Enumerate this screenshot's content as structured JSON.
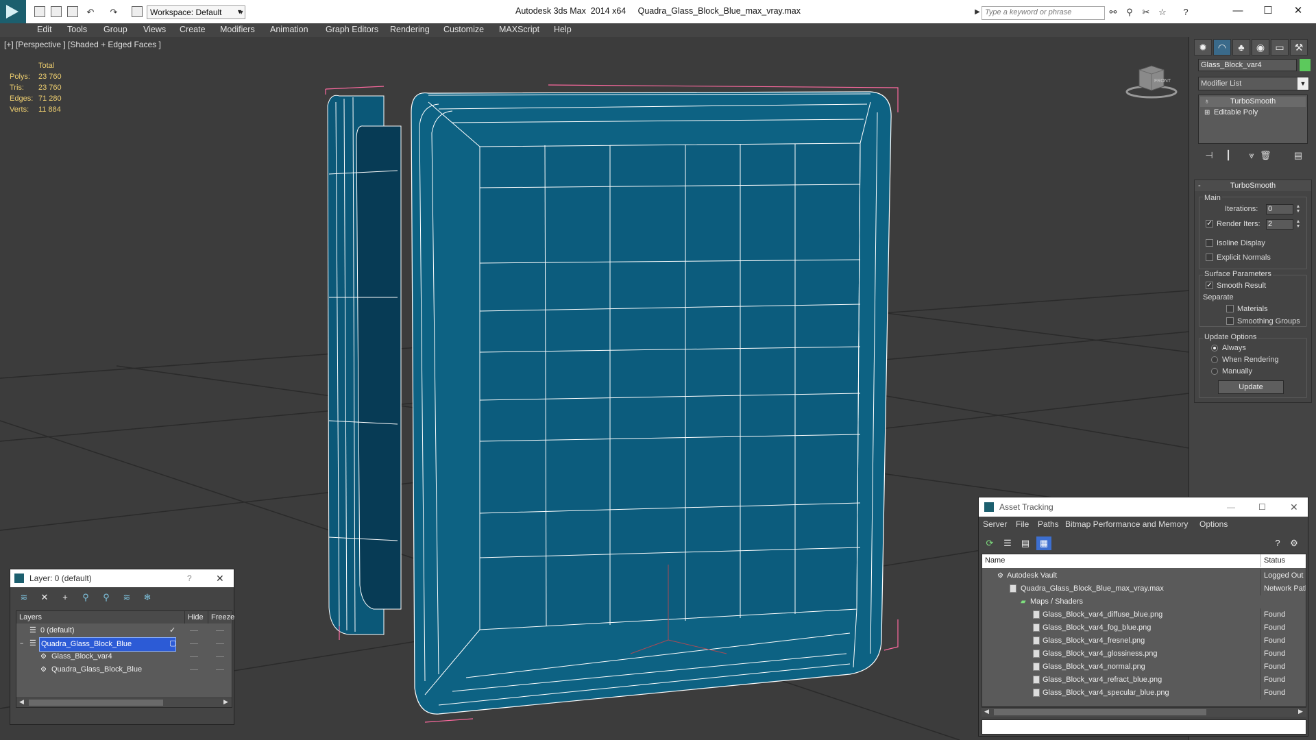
{
  "app": {
    "title": "Autodesk 3ds Max  2014 x64     Quadra_Glass_Block_Blue_max_vray.max",
    "workspace": "Workspace: Default",
    "search_placeholder": "Type a keyword or phrase"
  },
  "menu": [
    "Edit",
    "Tools",
    "Group",
    "Views",
    "Create",
    "Modifiers",
    "Animation",
    "Graph Editors",
    "Rendering",
    "Customize",
    "MAXScript",
    "Help"
  ],
  "viewport": {
    "label": "[+] [Perspective ] [Shaded + Edged Faces ]",
    "stats_header": "Total",
    "stats": [
      {
        "label": "Polys:",
        "value": "23 760"
      },
      {
        "label": "Tris:",
        "value": "23 760"
      },
      {
        "label": "Edges:",
        "value": "71 280"
      },
      {
        "label": "Verts:",
        "value": "11 884"
      }
    ],
    "viewcube_label": "FRONT",
    "colors": {
      "object": "#0d5f80",
      "wire": "#ffffff",
      "selection": "#ff6aa0",
      "background": "#3c3c3c"
    }
  },
  "command_panel": {
    "object_name": "Glass_Block_var4",
    "object_color": "#5cc95c",
    "modifier_list": "Modifier List",
    "stack": [
      "TurboSmooth",
      "Editable Poly"
    ],
    "rollout_title": "TurboSmooth",
    "main_label": "Main",
    "iterations_label": "Iterations:",
    "iterations_value": "0",
    "render_iters_label": "Render Iters:",
    "render_iters_value": "2",
    "isoline": "Isoline Display",
    "explicit_normals": "Explicit Normals",
    "surface_params": "Surface Parameters",
    "smooth_result": "Smooth Result",
    "separate": "Separate",
    "materials": "Materials",
    "smoothing_groups": "Smoothing Groups",
    "update_options": "Update Options",
    "always": "Always",
    "when_rendering": "When Rendering",
    "manually": "Manually",
    "update_button": "Update"
  },
  "layer_window": {
    "title": "Layer: 0 (default)",
    "help": "?",
    "col_layers": "Layers",
    "col_hide": "Hide",
    "col_freeze": "Freeze",
    "rows": [
      {
        "name": "0 (default)",
        "indent": 0,
        "selected": false
      },
      {
        "name": "Quadra_Glass_Block_Blue",
        "indent": 0,
        "selected": true
      },
      {
        "name": "Glass_Block_var4",
        "indent": 1,
        "selected": false
      },
      {
        "name": "Quadra_Glass_Block_Blue",
        "indent": 1,
        "selected": false
      }
    ]
  },
  "asset_window": {
    "title": "Asset Tracking",
    "menu": [
      "Server",
      "File",
      "Paths",
      "Bitmap Performance and Memory",
      "Options"
    ],
    "col_name": "Name",
    "col_status": "Status",
    "rows": [
      {
        "name": "Autodesk Vault",
        "status": "Logged Out",
        "indent": 0
      },
      {
        "name": "Quadra_Glass_Block_Blue_max_vray.max",
        "status": "Network Path",
        "indent": 1
      },
      {
        "name": "Maps / Shaders",
        "status": "",
        "indent": 2
      },
      {
        "name": "Glass_Block_var4_diffuse_blue.png",
        "status": "Found",
        "indent": 3
      },
      {
        "name": "Glass_Block_var4_fog_blue.png",
        "status": "Found",
        "indent": 3
      },
      {
        "name": "Glass_Block_var4_fresnel.png",
        "status": "Found",
        "indent": 3
      },
      {
        "name": "Glass_Block_var4_glossiness.png",
        "status": "Found",
        "indent": 3
      },
      {
        "name": "Glass_Block_var4_normal.png",
        "status": "Found",
        "indent": 3
      },
      {
        "name": "Glass_Block_var4_refract_blue.png",
        "status": "Found",
        "indent": 3
      },
      {
        "name": "Glass_Block_var4_specular_blue.png",
        "status": "Found",
        "indent": 3
      }
    ]
  }
}
